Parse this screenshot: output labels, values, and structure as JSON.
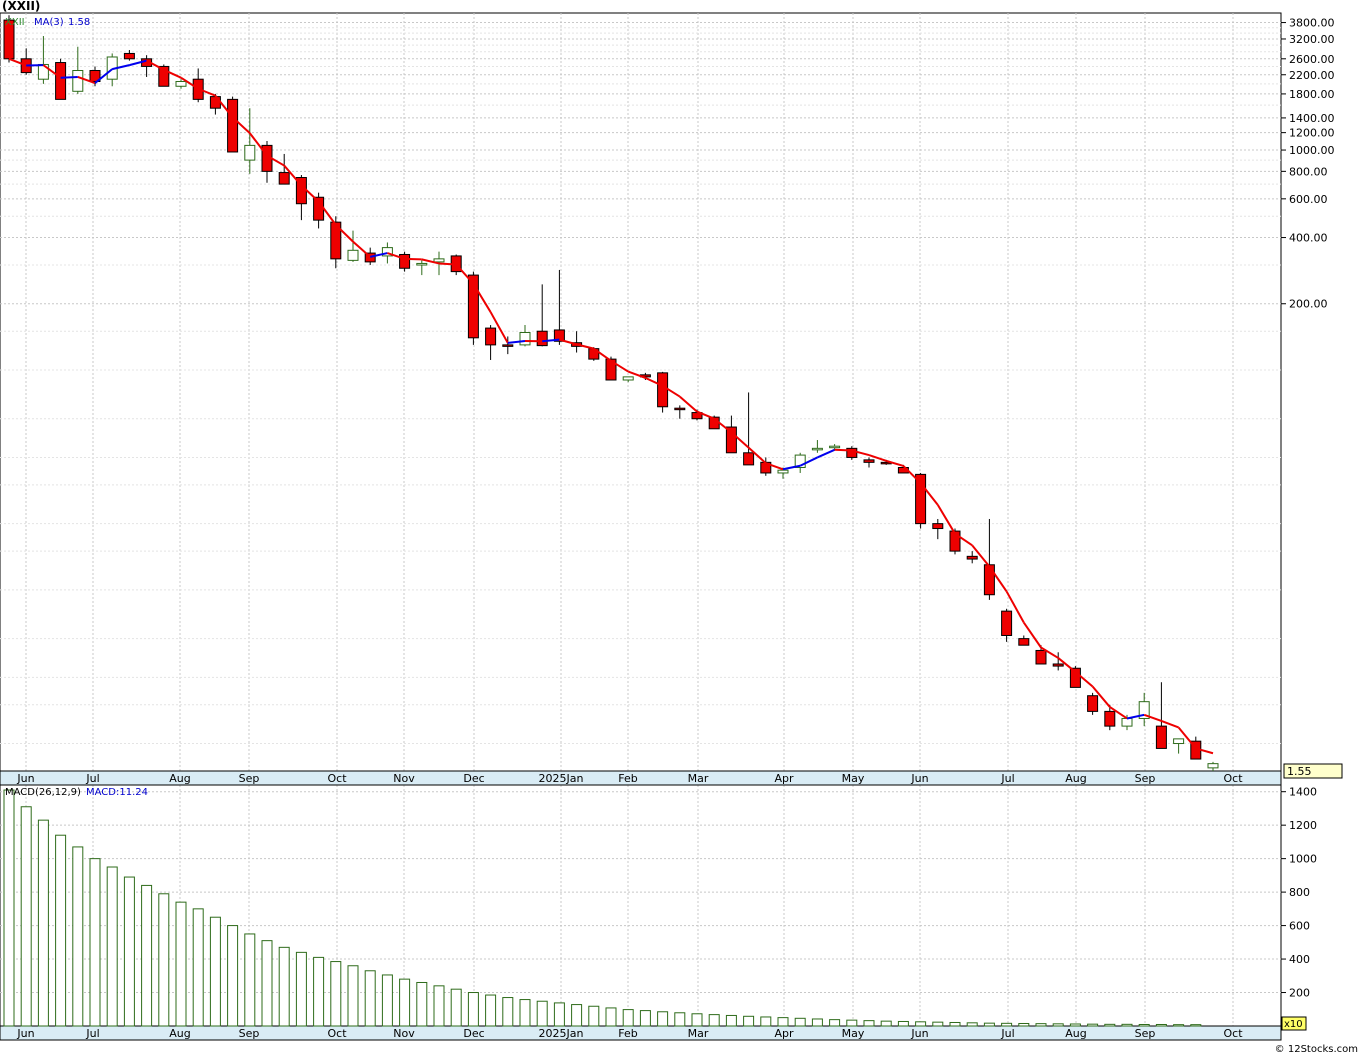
{
  "title": "(XXII)",
  "footer": "© 12Stocks.com",
  "chart_data": [
    {
      "type": "candlestick",
      "legend": {
        "symbol": "XXII",
        "ma_label": "MA(3)",
        "ma_value": "1.58"
      },
      "y_scale": "log",
      "ylim": [
        1.5,
        4200
      ],
      "y_ticks": [
        3800,
        3200,
        2600,
        2200,
        1800,
        1400,
        1200,
        1000,
        800,
        600,
        400,
        200
      ],
      "y_tick_labels": [
        "3800.00",
        "3200.00",
        "2600.00",
        "2200.00",
        "1800.00",
        "1400.00",
        "1200.00",
        "1000.00",
        "800.00",
        "600.00",
        "400.00",
        "200.00"
      ],
      "last_price_label": "1.55",
      "x_labels": [
        "Jun",
        "Jul",
        "Aug",
        "Sep",
        "Oct",
        "Nov",
        "Dec",
        "2025Jan",
        "Feb",
        "Mar",
        "Apr",
        "May",
        "Jun",
        "Jul",
        "Aug",
        "Sep",
        "Oct"
      ],
      "candles": [
        {
          "o": 3900,
          "h": 4100,
          "l": 2500,
          "c": 2600
        },
        {
          "o": 2600,
          "h": 2900,
          "l": 2200,
          "c": 2250
        },
        {
          "o": 2100,
          "h": 3300,
          "l": 2000,
          "c": 2450
        },
        {
          "o": 2500,
          "h": 2600,
          "l": 1700,
          "c": 1700
        },
        {
          "o": 1850,
          "h": 2950,
          "l": 1800,
          "c": 2300
        },
        {
          "o": 2300,
          "h": 2400,
          "l": 1950,
          "c": 2050
        },
        {
          "o": 2100,
          "h": 2750,
          "l": 1950,
          "c": 2650
        },
        {
          "o": 2750,
          "h": 2850,
          "l": 2550,
          "c": 2600
        },
        {
          "o": 2600,
          "h": 2700,
          "l": 2150,
          "c": 2400
        },
        {
          "o": 2400,
          "h": 2450,
          "l": 1950,
          "c": 1950
        },
        {
          "o": 1950,
          "h": 2100,
          "l": 1900,
          "c": 2050
        },
        {
          "o": 2100,
          "h": 2350,
          "l": 1650,
          "c": 1700
        },
        {
          "o": 1750,
          "h": 1800,
          "l": 1450,
          "c": 1550
        },
        {
          "o": 1700,
          "h": 1750,
          "l": 980,
          "c": 980
        },
        {
          "o": 900,
          "h": 1550,
          "l": 780,
          "c": 1050
        },
        {
          "o": 1050,
          "h": 1100,
          "l": 710,
          "c": 800
        },
        {
          "o": 790,
          "h": 960,
          "l": 700,
          "c": 700
        },
        {
          "o": 750,
          "h": 770,
          "l": 480,
          "c": 570
        },
        {
          "o": 610,
          "h": 640,
          "l": 440,
          "c": 480
        },
        {
          "o": 470,
          "h": 500,
          "l": 290,
          "c": 320
        },
        {
          "o": 315,
          "h": 430,
          "l": 310,
          "c": 350
        },
        {
          "o": 340,
          "h": 360,
          "l": 300,
          "c": 310
        },
        {
          "o": 330,
          "h": 380,
          "l": 305,
          "c": 360
        },
        {
          "o": 335,
          "h": 345,
          "l": 280,
          "c": 290
        },
        {
          "o": 300,
          "h": 315,
          "l": 270,
          "c": 305
        },
        {
          "o": 310,
          "h": 345,
          "l": 270,
          "c": 320
        },
        {
          "o": 330,
          "h": 335,
          "l": 270,
          "c": 280
        },
        {
          "o": 270,
          "h": 280,
          "l": 130,
          "c": 140
        },
        {
          "o": 155,
          "h": 160,
          "l": 111,
          "c": 130
        },
        {
          "o": 130,
          "h": 142,
          "l": 118,
          "c": 128
        },
        {
          "o": 130,
          "h": 160,
          "l": 128,
          "c": 148
        },
        {
          "o": 150,
          "h": 245,
          "l": 128,
          "c": 129
        },
        {
          "o": 152,
          "h": 285,
          "l": 130,
          "c": 135
        },
        {
          "o": 133,
          "h": 150,
          "l": 120,
          "c": 128
        },
        {
          "o": 125,
          "h": 127,
          "l": 110,
          "c": 112
        },
        {
          "o": 112,
          "h": 115,
          "l": 90,
          "c": 90
        },
        {
          "o": 90,
          "h": 93,
          "l": 88,
          "c": 93
        },
        {
          "o": 95,
          "h": 97,
          "l": 90,
          "c": 93
        },
        {
          "o": 97,
          "h": 98,
          "l": 64,
          "c": 68
        },
        {
          "o": 67,
          "h": 69,
          "l": 60,
          "c": 66
        },
        {
          "o": 64,
          "h": 66,
          "l": 59,
          "c": 60
        },
        {
          "o": 61,
          "h": 62,
          "l": 54,
          "c": 54
        },
        {
          "o": 55,
          "h": 62,
          "l": 44,
          "c": 42
        },
        {
          "o": 42,
          "h": 79,
          "l": 38,
          "c": 37
        },
        {
          "o": 38,
          "h": 40,
          "l": 33,
          "c": 34
        },
        {
          "o": 34,
          "h": 36,
          "l": 32,
          "c": 35
        },
        {
          "o": 36,
          "h": 42,
          "l": 34,
          "c": 41
        },
        {
          "o": 44,
          "h": 48,
          "l": 42,
          "c": 44
        },
        {
          "o": 45,
          "h": 46,
          "l": 43,
          "c": 45
        },
        {
          "o": 44,
          "h": 45,
          "l": 39,
          "c": 40
        },
        {
          "o": 39,
          "h": 40,
          "l": 36,
          "c": 38
        },
        {
          "o": 38,
          "h": 39,
          "l": 37,
          "c": 37.8
        },
        {
          "o": 36,
          "h": 37,
          "l": 34,
          "c": 34
        },
        {
          "o": 33.5,
          "h": 34,
          "l": 19,
          "c": 20
        },
        {
          "o": 20,
          "h": 21,
          "l": 17,
          "c": 19
        },
        {
          "o": 18.5,
          "h": 19,
          "l": 14.5,
          "c": 15
        },
        {
          "o": 14.2,
          "h": 15,
          "l": 13.2,
          "c": 13.8
        },
        {
          "o": 13,
          "h": 21,
          "l": 9,
          "c": 9.5
        },
        {
          "o": 8,
          "h": 8.2,
          "l": 5.8,
          "c": 6.2
        },
        {
          "o": 6,
          "h": 6.2,
          "l": 5.8,
          "c": 5.6
        },
        {
          "o": 5.3,
          "h": 5.6,
          "l": 4.6,
          "c": 4.6
        },
        {
          "o": 4.6,
          "h": 5.2,
          "l": 4.3,
          "c": 4.5
        },
        {
          "o": 4.4,
          "h": 4.5,
          "l": 3.6,
          "c": 3.6
        },
        {
          "o": 3.3,
          "h": 3.4,
          "l": 2.7,
          "c": 2.8
        },
        {
          "o": 2.8,
          "h": 3,
          "l": 2.3,
          "c": 2.4
        },
        {
          "o": 2.4,
          "h": 2.7,
          "l": 2.3,
          "c": 2.6
        },
        {
          "o": 2.6,
          "h": 3.4,
          "l": 2.4,
          "c": 3.1
        },
        {
          "o": 2.4,
          "h": 3.8,
          "l": 1.9,
          "c": 1.9
        },
        {
          "o": 2,
          "h": 2.1,
          "l": 1.8,
          "c": 2.1
        },
        {
          "o": 2.05,
          "h": 2.15,
          "l": 1.7,
          "c": 1.7
        },
        {
          "o": 1.55,
          "h": 1.65,
          "l": 1.5,
          "c": 1.62
        }
      ]
    },
    {
      "type": "bar",
      "legend": {
        "name": "MACD(26,12,9)",
        "value_label": "MACD:11.24"
      },
      "ylim": [
        0,
        1440
      ],
      "y_ticks": [
        200,
        400,
        600,
        800,
        1000,
        1200,
        1400
      ],
      "scale_label": "x10",
      "values": [
        1410,
        1310,
        1230,
        1140,
        1070,
        1000,
        950,
        890,
        840,
        790,
        740,
        700,
        650,
        600,
        550,
        510,
        470,
        440,
        410,
        385,
        360,
        330,
        305,
        280,
        260,
        240,
        220,
        200,
        185,
        170,
        158,
        148,
        138,
        128,
        118,
        108,
        98,
        92,
        85,
        79,
        73,
        68,
        63,
        58,
        54,
        50,
        46,
        42,
        38,
        35,
        32,
        29,
        27,
        25,
        23,
        21,
        19,
        17,
        16,
        15,
        14,
        13,
        12,
        11,
        10,
        10,
        9,
        9,
        8,
        8
      ]
    }
  ]
}
